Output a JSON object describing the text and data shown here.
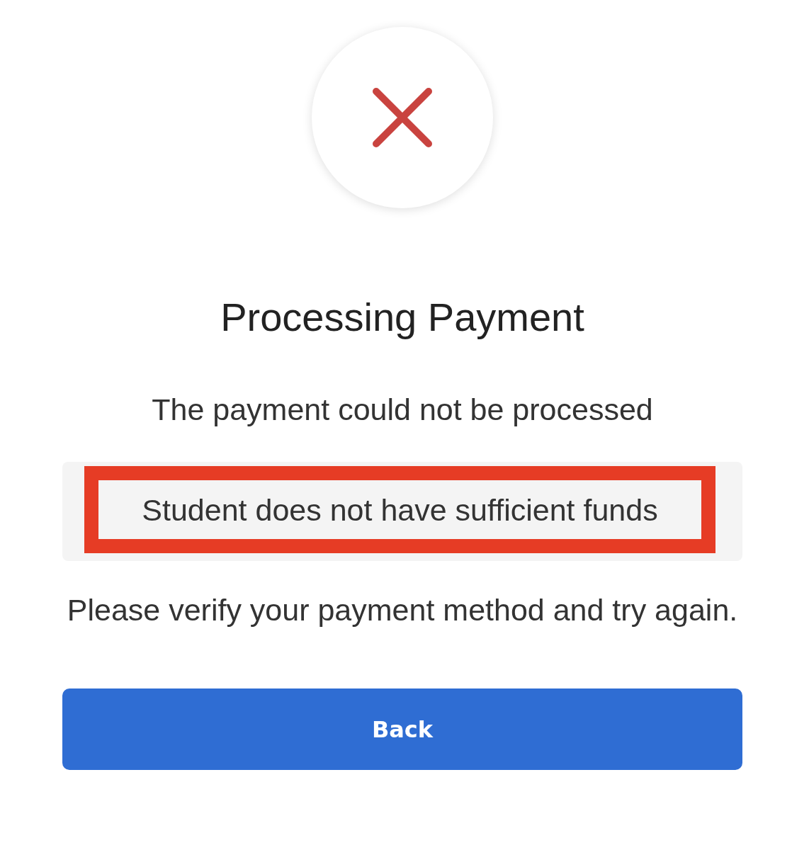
{
  "status": {
    "kind": "error"
  },
  "title": "Processing Payment",
  "message": "The payment could not be processed",
  "error": {
    "text": "Student does not have sufficient funds",
    "highlighted": true
  },
  "instruction": "Please verify your payment method and try again.",
  "buttons": [
    {
      "label": "Back",
      "kind": "primary"
    }
  ]
}
